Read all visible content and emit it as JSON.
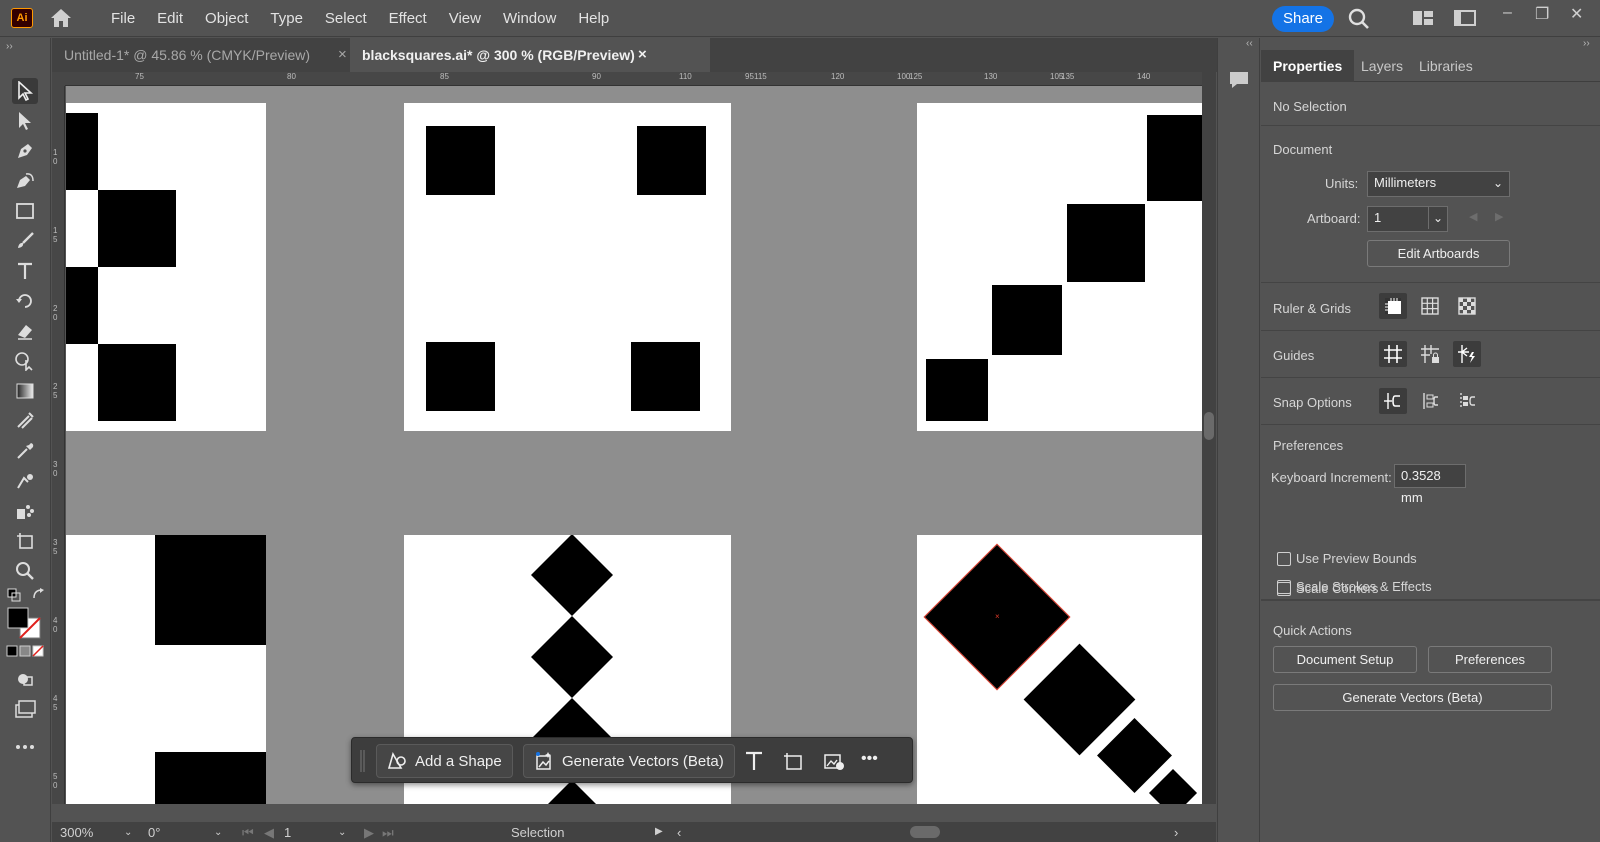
{
  "app": {
    "logo_text": "Ai"
  },
  "menu": [
    "File",
    "Edit",
    "Object",
    "Type",
    "Select",
    "Effect",
    "View",
    "Window",
    "Help"
  ],
  "share_label": "Share",
  "tabs": [
    {
      "label": "Untitled-1* @ 45.86 % (CMYK/Preview)",
      "close": "×"
    },
    {
      "label": "blacksquares.ai* @ 300 % (RGB/Preview)",
      "close": "×"
    }
  ],
  "ruler_h": [
    "75",
    "80",
    "85",
    "90",
    "95",
    "100",
    "105",
    "110",
    "115",
    "120",
    "125",
    "130",
    "135",
    "140"
  ],
  "ruler_v": [
    "1 0",
    "1 5",
    "2 0",
    "2 5",
    "3 0",
    "3 5",
    "4 0",
    "4 5",
    "5 0"
  ],
  "taskbar": {
    "add_shape": "Add a Shape",
    "generate_vectors": "Generate Vectors (Beta)",
    "more": "•••"
  },
  "status": {
    "zoom": "300%",
    "rotation": "0°",
    "artboard": "1",
    "tool": "Selection"
  },
  "panel": {
    "tabs": [
      "Properties",
      "Layers",
      "Libraries"
    ],
    "selection": "No Selection",
    "document_title": "Document",
    "units_label": "Units:",
    "units_value": "Millimeters",
    "artboard_label": "Artboard:",
    "artboard_value": "1",
    "edit_artboards": "Edit Artboards",
    "ruler_grids": "Ruler & Grids",
    "guides": "Guides",
    "snap_options": "Snap Options",
    "preferences_title": "Preferences",
    "keyboard_increment_label": "Keyboard Increment:",
    "keyboard_increment_value": "0.3528 mm",
    "use_preview_bounds": "Use Preview Bounds",
    "scale_corners": "Scale Corners",
    "scale_strokes": "Scale Strokes & Effects",
    "quick_actions": "Quick Actions",
    "document_setup": "Document Setup",
    "preferences_btn": "Preferences",
    "generate_vectors": "Generate Vectors (Beta)"
  }
}
